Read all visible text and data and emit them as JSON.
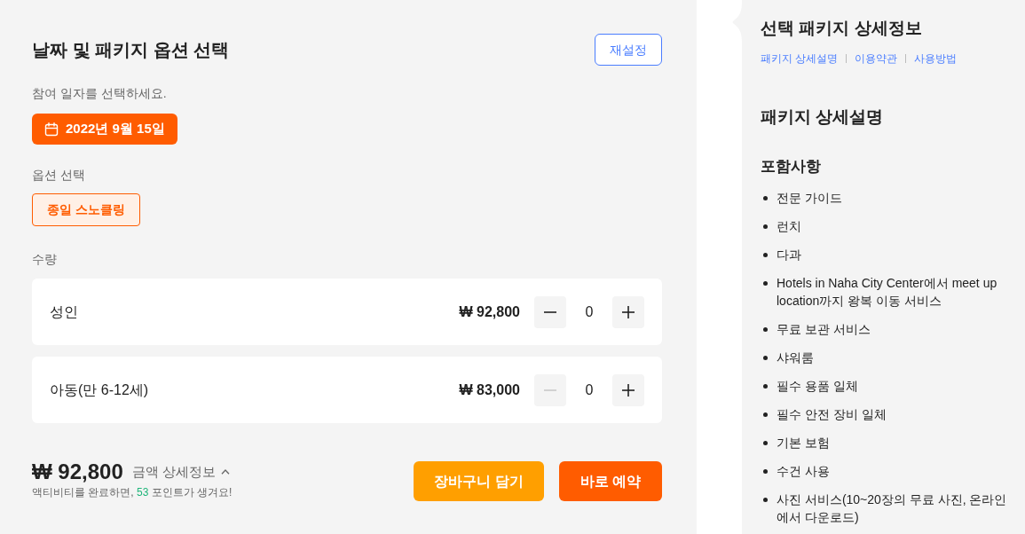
{
  "booking": {
    "title": "날짜 및 패키지 옵션 선택",
    "reset_button": "재설정",
    "date_prompt": "참여 일자를 선택하세요.",
    "date_button": "2022년 9월 15일",
    "option_label": "옵션 선택",
    "options": [
      {
        "label": "종일 스노클링",
        "selected": true
      }
    ],
    "quantity_label": "수량",
    "tickets": [
      {
        "name": "성인",
        "price": "₩ 92,800",
        "count": "0",
        "minus_disabled": false
      },
      {
        "name": "아동(만 6-12세)",
        "price": "₩ 83,000",
        "count": "0",
        "minus_disabled": true
      }
    ]
  },
  "summary": {
    "total": "₩ 92,800",
    "detail_toggle": "금액 상세정보",
    "points_note": {
      "before": "액티비티를 완료하면, ",
      "points": "53",
      "after": " 포인트가 생겨요!"
    },
    "buttons": [
      {
        "label": "장바구니 담기",
        "kind": "cart"
      },
      {
        "label": "바로 예약",
        "kind": "book"
      }
    ]
  },
  "details": {
    "title": "선택 패키지 상세정보",
    "links": [
      "패키지 상세설명",
      "이용약관",
      "사용방법"
    ],
    "section_title": "패키지 상세설명",
    "included_title": "포함사항",
    "included": [
      "전문 가이드",
      "런치",
      "다과",
      "Hotels in Naha City Center에서 meet up location까지 왕복 이동 서비스",
      "무료 보관 서비스",
      "샤워룸",
      "필수 용품 일체",
      "필수 안전 장비 일체",
      "기본 보험",
      "수건 사용",
      "사진 서비스(10~20장의 무료 사진, 온라인에서 다운로드)"
    ]
  }
}
